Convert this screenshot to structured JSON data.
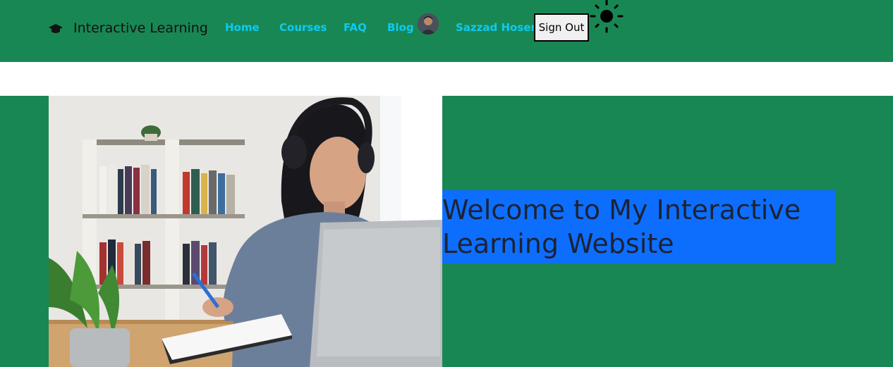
{
  "navbar": {
    "brand_icon": "graduation-cap-icon",
    "brand_text": "Interactive Learning",
    "links": [
      {
        "label": "Home"
      },
      {
        "label": "Courses"
      },
      {
        "label": "FAQ"
      },
      {
        "label": "Blog"
      }
    ],
    "user_name": "Sazzad Hosen",
    "sign_out_label": "Sign Out",
    "theme_icon": "sun-icon",
    "link_color": "#0dcaf0"
  },
  "hero": {
    "title": "Welcome to My Interactive Learning Website",
    "image": "student-laptop-headphones-photo"
  },
  "colors": {
    "navbar_bg": "#198754",
    "hero_bg": "#198754",
    "title_box_bg": "#0d6efd",
    "title_text": "#1c2333"
  }
}
